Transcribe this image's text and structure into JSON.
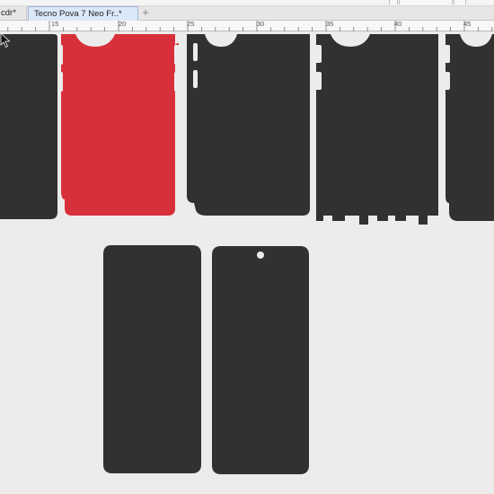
{
  "tabs": [
    {
      "label": "cdr*"
    },
    {
      "label": "Tecno Pova 7 Neo Fr..*"
    }
  ],
  "tab_add_glyph": "+",
  "ruler": {
    "labels": [
      {
        "text": "15"
      },
      {
        "text": "20"
      },
      {
        "text": "25"
      },
      {
        "text": "30"
      },
      {
        "text": "35"
      },
      {
        "text": "40"
      },
      {
        "text": "45"
      }
    ]
  },
  "colors": {
    "skin_dark": "#323031",
    "skin_red": "#d8303a",
    "canvas": "#ececec",
    "tab_active": "#dbe8f8"
  },
  "icons": {
    "add_tab": "plus-icon",
    "pointer": "mouse-pointer-icon"
  }
}
